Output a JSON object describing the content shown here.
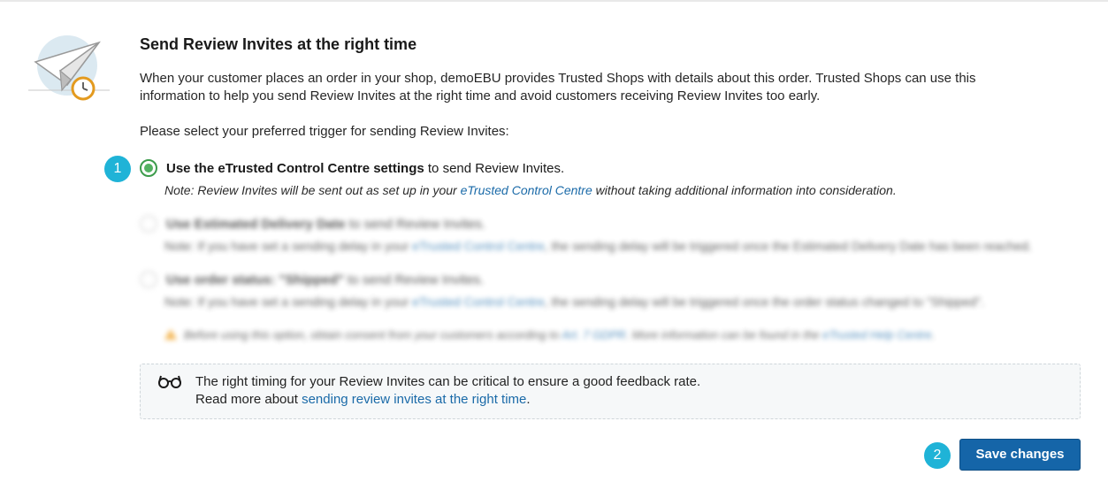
{
  "header": {
    "title": "Send Review Invites at the right time",
    "description": "When your customer places an order in your shop, demoEBU provides Trusted Shops with details about this order. Trusted Shops can use this information to help you send Review Invites at the right time and avoid customers receiving Review Invites too early.",
    "prompt": "Please select your preferred trigger for sending Review Invites:"
  },
  "markers": {
    "first": "1",
    "second": "2"
  },
  "options": [
    {
      "label_bold": "Use the eTrusted Control Centre settings",
      "label_rest": " to send Review Invites.",
      "note_prefix": "Note: Review Invites will be sent out as set up in your ",
      "note_link": "eTrusted Control Centre",
      "note_suffix": " without taking additional information into consideration.",
      "selected": true
    },
    {
      "label_bold": "Use Estimated Delivery Date",
      "label_rest": " to send Review Invites.",
      "note_prefix": "Note: If you have set a sending delay in your ",
      "note_link": "eTrusted Control Centre",
      "note_suffix": ", the sending delay will be triggered once the Estimated Delivery Date has been reached.",
      "selected": false
    },
    {
      "label_bold": "Use order status: \"Shipped\"",
      "label_rest": " to send Review Invites.",
      "note_prefix": "Note: If you have set a sending delay in your ",
      "note_link": "eTrusted Control Centre",
      "note_suffix": ", the sending delay will be triggered once the order status changed to \"Shipped\".",
      "selected": false
    }
  ],
  "warning": {
    "prefix": "Before using this option, obtain consent from your customers according to ",
    "link1": "Art. 7 GDPR",
    "middle": ". More information can be found in the ",
    "link2": "eTrusted Help Centre",
    "suffix": "."
  },
  "info": {
    "icon": "glasses-icon",
    "line1": "The right timing for your Review Invites can be critical to ensure a good feedback rate.",
    "line2_prefix": "Read more about ",
    "line2_link": "sending review invites at the right time",
    "line2_suffix": "."
  },
  "actions": {
    "save_label": "Save changes"
  },
  "colors": {
    "accent": "#1565a8",
    "marker": "#1fb3d7",
    "radio_selected": "#54b162",
    "link": "#1a6aa8"
  }
}
